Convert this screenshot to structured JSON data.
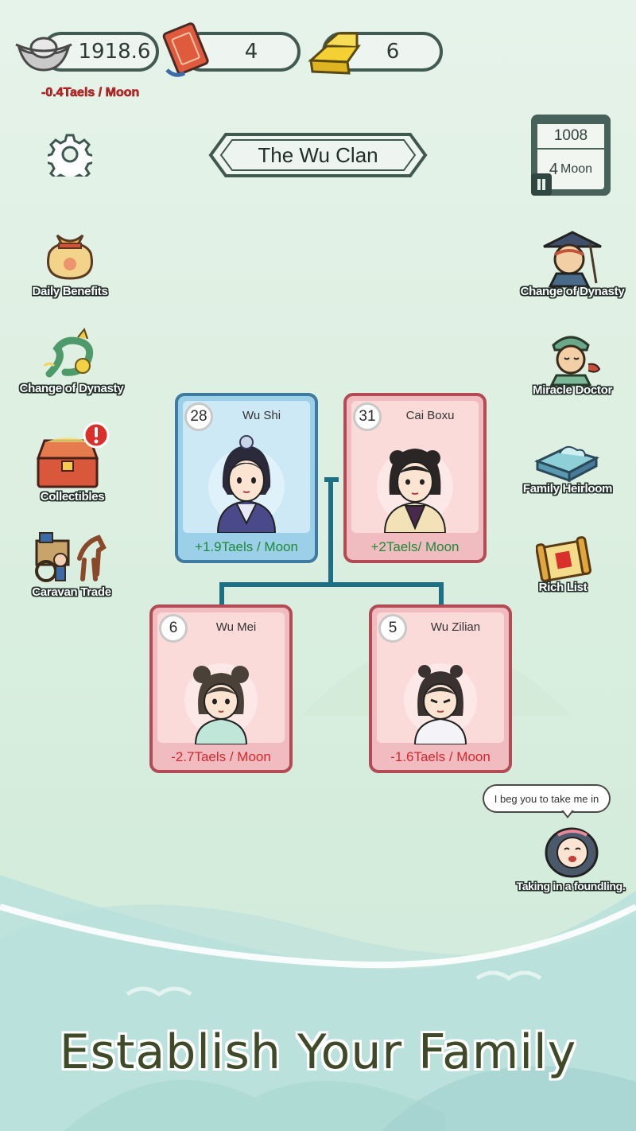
{
  "resources": {
    "silver": {
      "icon": "silver-ingot-icon",
      "value": "1918.6",
      "rate": "-0.4Taels / Moon"
    },
    "token": {
      "icon": "order-token-icon",
      "value": "4"
    },
    "gold": {
      "icon": "gold-bar-icon",
      "value": "6"
    }
  },
  "header": {
    "clan_name": "The Wu Clan"
  },
  "calendar": {
    "year": "1008",
    "moon_number": "4",
    "moon_label": "Moon"
  },
  "left_menu": [
    {
      "label": "Daily Benefits",
      "icon": "treasure-bag-icon"
    },
    {
      "label": "Change of Dynasty",
      "icon": "dragon-icon"
    },
    {
      "label": "Collectibles",
      "icon": "treasure-chest-icon"
    },
    {
      "label": "Caravan Trade",
      "icon": "horse-cart-icon"
    }
  ],
  "right_menu": [
    {
      "label": "Change of Dynasty",
      "icon": "scholar-portrait-icon"
    },
    {
      "label": "Miracle Doctor",
      "icon": "doctor-portrait-icon"
    },
    {
      "label": "Family Heirloom",
      "icon": "jade-seal-icon"
    },
    {
      "label": "Rich List",
      "icon": "scroll-icon"
    }
  ],
  "family": {
    "parents": [
      {
        "age": "28",
        "name": "Wu Shi",
        "income": "+1.9Taels / Moon"
      },
      {
        "age": "31",
        "name": "Cai Boxu",
        "income": "+2Taels/ Moon"
      }
    ],
    "children": [
      {
        "age": "6",
        "name": "Wu Mei",
        "income": "-2.7Taels / Moon"
      },
      {
        "age": "5",
        "name": "Wu Zilian",
        "income": "-1.6Taels / Moon"
      }
    ]
  },
  "foundling": {
    "speech": "I beg you to take me in",
    "label": "Taking in a foundling."
  },
  "slogan": "Establish Your Family",
  "colors": {
    "accent": "#415a52",
    "positive": "#1f8a3a",
    "negative": "#d6272d",
    "tree_line": "#1f6f84"
  }
}
